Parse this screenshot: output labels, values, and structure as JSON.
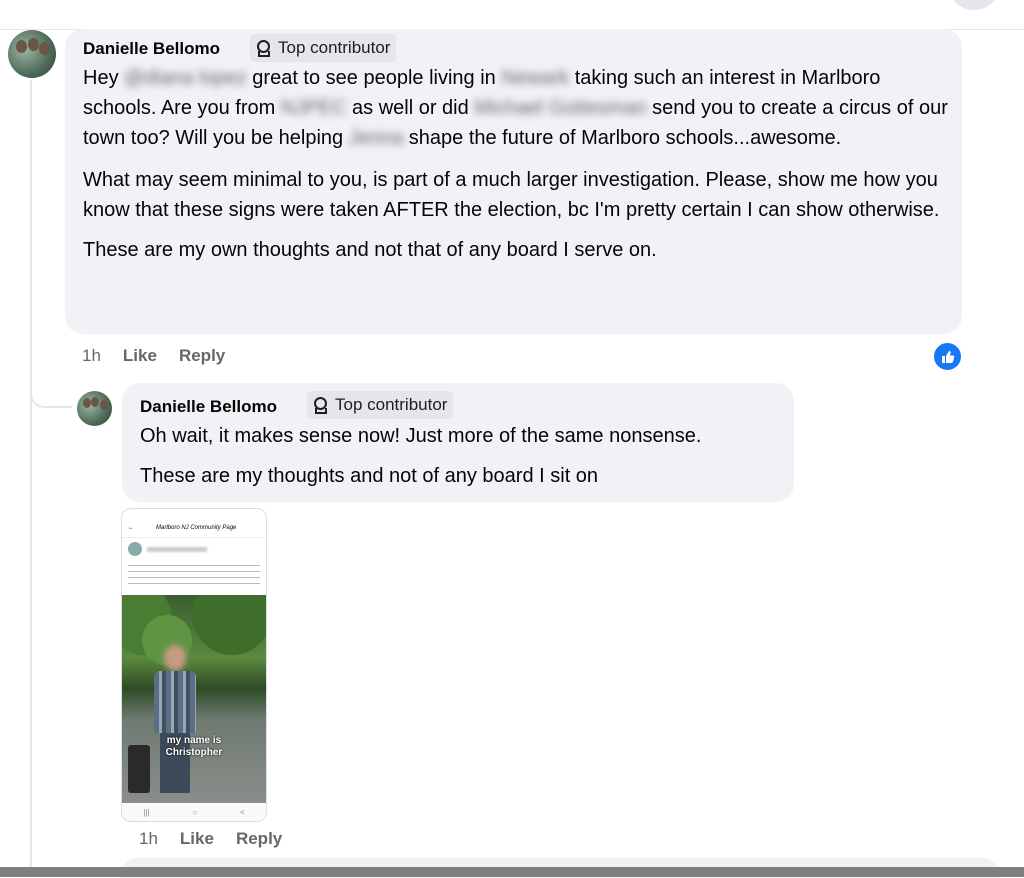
{
  "comments": [
    {
      "author": "Danielle Bellomo",
      "badge": "Top contributor",
      "paragraph1": {
        "t1": "Hey ",
        "blur1": "@diana lopez",
        "t2": " great to see people living in ",
        "blur2": "Newark",
        "t3": " taking such an interest in Marlboro schools. Are you from ",
        "blur3": "NJPEC",
        "t4": " as well or did ",
        "blur4": "Michael Gottesman",
        "t5": " send you to create a circus of our town too? Will you be helping ",
        "blur5": "Jenna",
        "t6": " shape the future of Marlboro schools...awesome."
      },
      "paragraph2": "What may seem minimal to you, is part of a much larger investigation. Please, show me how you know that these signs were taken AFTER the election, bc I'm pretty certain I can show otherwise.",
      "paragraph3": "These are my own thoughts and not that of any board I serve on.",
      "time": "1h",
      "like": "Like",
      "reply": "Reply"
    },
    {
      "author": "Danielle Bellomo",
      "badge": "Top contributor",
      "paragraph1": "Oh wait, it makes sense now! Just more of the same nonsense.",
      "paragraph2": "These are my thoughts and not of any board I sit on",
      "time": "1h",
      "like": "Like",
      "reply": "Reply"
    }
  ],
  "screenshot": {
    "group_title": "Marlboro NJ Community Page",
    "caption_line1": "my name is",
    "caption_line2": "Christopher"
  },
  "icons": {
    "badge": "contributor-badge-icon",
    "like_reaction": "thumbs-up-icon"
  },
  "colors": {
    "bubble": "#f0f2f5",
    "badge": "#e4e6eb",
    "like_blue": "#1877f2",
    "meta_gray": "#65676b"
  }
}
